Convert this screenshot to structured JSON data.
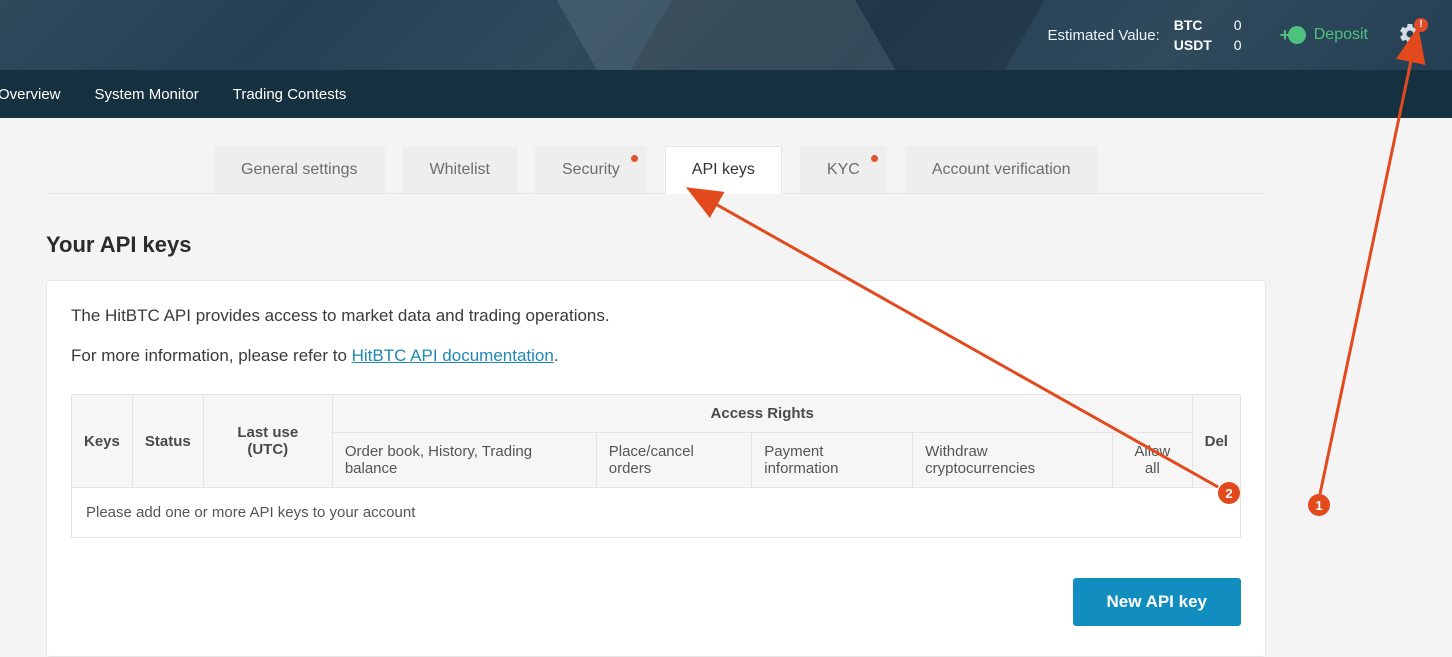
{
  "header": {
    "estimated_label": "Estimated Value:",
    "balances": [
      {
        "symbol": "BTC",
        "value": "0"
      },
      {
        "symbol": "USDT",
        "value": "0"
      }
    ],
    "deposit_label": "Deposit",
    "gear_badge": "!"
  },
  "nav": {
    "overview": "Overview",
    "system_monitor": "System Monitor",
    "trading_contests": "Trading Contests"
  },
  "tabs": {
    "general": "General settings",
    "whitelist": "Whitelist",
    "security": "Security",
    "api_keys": "API keys",
    "kyc": "KYC",
    "account": "Account verification"
  },
  "section_title": "Your API keys",
  "desc_line1": "The HitBTC API provides access to market data and trading operations.",
  "desc_line2_prefix": "For more information, please refer to ",
  "doc_link_text": "HitBTC API documentation",
  "desc_line2_suffix": ".",
  "table": {
    "access_rights_header": "Access Rights",
    "cols": {
      "keys": "Keys",
      "status": "Status",
      "last_use": "Last use (UTC)",
      "order_book": "Order book, History, Trading balance",
      "place_cancel": "Place/cancel orders",
      "payment_info": "Payment information",
      "withdraw": "Withdraw cryptocurrencies",
      "allow_all": "Allow all",
      "del": "Del"
    },
    "empty_row": "Please add one or more API keys to your account"
  },
  "new_key_button": "New API key",
  "annotations": {
    "badge1": "1",
    "badge2": "2"
  }
}
